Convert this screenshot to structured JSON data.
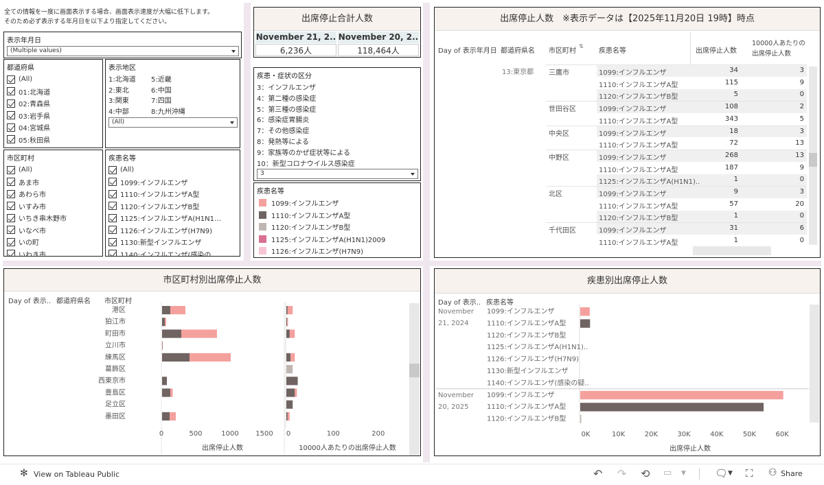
{
  "notice": {
    "line1": "全ての情報を一度に画面表示する場合、画面表示速度が大幅に低下します。",
    "line2": "そのため必ず表示する年月日を以下より指定してください。"
  },
  "date_filter": {
    "title": "表示年月日",
    "value": "(Multiple values)"
  },
  "pref_filter": {
    "title": "都道府県",
    "items": [
      "(All)",
      "01:北海道",
      "02:青森県",
      "03:岩手県",
      "04:宮城県",
      "05:秋田県"
    ]
  },
  "region_filter": {
    "title": "表示地区",
    "rows": [
      [
        "1:北海道",
        "5:近畿"
      ],
      [
        "2:東北",
        "6:中国"
      ],
      [
        "3:関東",
        "7:四国"
      ],
      [
        "4:中部",
        "8:九州沖縄"
      ]
    ],
    "value": "(All)"
  },
  "city_filter": {
    "title": "市区町村",
    "items": [
      "(All)",
      "あま市",
      "あわら市",
      "いすみ市",
      "いちき串木野市",
      "いなべ市",
      "いの町",
      "いわき市"
    ]
  },
  "disease_filter": {
    "title": "疾患名等",
    "items": [
      "(All)",
      "1099:インフルエンザ",
      "1110:インフルエンザA型",
      "1120:インフルエンザB型",
      "1125:インフルエンザA(H1N1…",
      "1126:インフルエンザ(H7N9)",
      "1130:新型インフルエンザ",
      "1140:インフルエンザ(感染の"
    ]
  },
  "total": {
    "title": "出席停止合計人数",
    "headers": [
      "November 21, 2..",
      "November 20, 2.."
    ],
    "values": [
      "6,236人",
      "118,464人"
    ]
  },
  "category_filter": {
    "title": "疾患・症状の区分",
    "items": [
      "3：インフルエンザ",
      "4：第二種の感染症",
      "5：第三種の感染症",
      "6：感染症胃腸炎",
      "7：その他感染症",
      "8：発熱等による",
      "9：家族等のかぜ症状等による",
      "10：新型コロナウイルス感染症"
    ],
    "value": "3"
  },
  "disease_legend": {
    "title": "疾患名等",
    "items": [
      {
        "label": "1099:インフルエンザ",
        "color": "#f4a19e"
      },
      {
        "label": "1110:インフルエンザA型",
        "color": "#6f6462"
      },
      {
        "label": "1120:インフルエンザB型",
        "color": "#bfb6b2"
      },
      {
        "label": "1125:インフルエンザA(H1N1)2009",
        "color": "#d9708f"
      },
      {
        "label": "1126:インフルエンザ(H7N9)",
        "color": "#f7c5d3"
      }
    ]
  },
  "table": {
    "title": "出席停止人数　※表示データは【2025年11月20日 19時】時点",
    "headers": {
      "date": "Day of 表示年月日",
      "pref": "都道府県名",
      "city": "市区町村",
      "disease": "疾患名等",
      "count": "出席停止人数",
      "rate": "10000人あたりの出席停止人数"
    },
    "pref_value": "13:東京都",
    "cities": [
      "三鷹市",
      "世田谷区",
      "中央区",
      "中野区",
      "北区",
      "千代田区"
    ],
    "rows": [
      {
        "disease": "1099:インフルエンザ",
        "count": "34",
        "rate": "3"
      },
      {
        "disease": "1110:インフルエンザA型",
        "count": "115",
        "rate": "9"
      },
      {
        "disease": "1120:インフルエンザB型",
        "count": "5",
        "rate": "0"
      },
      {
        "disease": "1099:インフルエンザ",
        "count": "108",
        "rate": "2"
      },
      {
        "disease": "1110:インフルエンザA型",
        "count": "343",
        "rate": "5"
      },
      {
        "disease": "1099:インフルエンザ",
        "count": "18",
        "rate": "3"
      },
      {
        "disease": "1110:インフルエンザA型",
        "count": "72",
        "rate": "13"
      },
      {
        "disease": "1099:インフルエンザ",
        "count": "268",
        "rate": "13"
      },
      {
        "disease": "1110:インフルエンザA型",
        "count": "187",
        "rate": "9"
      },
      {
        "disease": "1125:インフルエンザA(H1N1)..",
        "count": "1",
        "rate": "0"
      },
      {
        "disease": "1099:インフルエンザ",
        "count": "9",
        "rate": "3"
      },
      {
        "disease": "1110:インフルエンザA型",
        "count": "57",
        "rate": "20"
      },
      {
        "disease": "1120:インフルエンザB型",
        "count": "1",
        "rate": "0"
      },
      {
        "disease": "1099:インフルエンザ",
        "count": "31",
        "rate": "6"
      },
      {
        "disease": "1110:インフルエンザA型",
        "count": "1",
        "rate": "0"
      }
    ]
  },
  "chart_data": [
    {
      "type": "bar",
      "title": "市区町村別出席停止人数",
      "headers": [
        "Day of 表示..",
        "都道府県名",
        "市区町村"
      ],
      "categories": [
        "港区",
        "狛江市",
        "町田市",
        "立川市",
        "練馬区",
        "葛飾区",
        "西東京市",
        "豊島区",
        "足立区",
        "墨田区"
      ],
      "series": [
        {
          "name": "1110:インフルエンザA型",
          "color": "#6f6462",
          "values": [
            120,
            40,
            280,
            5,
            400,
            0,
            70,
            120,
            0,
            110
          ]
        },
        {
          "name": "1099:インフルエンザ",
          "color": "#f4a19e",
          "values": [
            220,
            20,
            520,
            5,
            600,
            0,
            0,
            35,
            0,
            90
          ]
        },
        {
          "name": "1120:インフルエンザB型",
          "color": "#bfb6b2",
          "values": [
            0,
            0,
            0,
            0,
            0,
            0,
            0,
            0,
            0,
            0
          ]
        }
      ],
      "xlabel": "出席停止人数",
      "xticks": [
        "0",
        "500",
        "1000",
        "1500"
      ],
      "xlim": [
        0,
        1600
      ],
      "rate_series": [
        {
          "name": "1110:インフルエンザA型",
          "color": "#6f6462",
          "values": [
            3,
            2,
            8,
            0,
            10,
            0,
            27,
            20,
            15,
            3
          ]
        },
        {
          "name": "1099:インフルエンザ",
          "color": "#f4a19e",
          "values": [
            12,
            2,
            12,
            0,
            10,
            0,
            0,
            5,
            0,
            5
          ]
        },
        {
          "name": "1120:インフルエンザB型",
          "color": "#bfb6b2",
          "values": [
            0,
            0,
            0,
            0,
            0,
            15,
            0,
            0,
            0,
            0
          ]
        }
      ],
      "rate_xlabel": "10000人あたりの出席停止人数",
      "rate_xticks": [
        "0",
        "100",
        "200"
      ],
      "rate_xlim": [
        0,
        260
      ]
    },
    {
      "type": "bar",
      "title": "疾患別出席停止人数",
      "headers": [
        "Day of 表示..",
        "疾患名等"
      ],
      "groups": [
        {
          "date": [
            "November",
            "21, 2024"
          ],
          "items": [
            {
              "label": "1099:インフルエンザ",
              "value": 2900,
              "color": "#f4a19e"
            },
            {
              "label": "1110:インフルエンザA型",
              "value": 3000,
              "color": "#6f6462"
            },
            {
              "label": "1120:インフルエンザB型",
              "value": 0,
              "color": "#bfb6b2"
            },
            {
              "label": "1125:インフルエンザA(H1N1)..",
              "value": 0,
              "color": "#d9708f"
            },
            {
              "label": "1126:インフルエンザ(H7N9)",
              "value": 0,
              "color": "#f7c5d3"
            },
            {
              "label": "1130:新型インフルエンザ",
              "value": 0,
              "color": "#f4a19e"
            },
            {
              "label": "1140:インフルエンザ(感染の疑..",
              "value": 0,
              "color": "#f4a19e"
            }
          ]
        },
        {
          "date": [
            "November",
            "20, 2025"
          ],
          "items": [
            {
              "label": "1099:インフルエンザ",
              "value": 62000,
              "color": "#f4a19e"
            },
            {
              "label": "1110:インフルエンザA型",
              "value": 56000,
              "color": "#6f6462"
            },
            {
              "label": "1120:インフルエンザB型",
              "value": 300,
              "color": "#bfb6b2"
            }
          ]
        }
      ],
      "xlabel": "出席停止人数",
      "xticks": [
        "0K",
        "10K",
        "20K",
        "30K",
        "40K",
        "50K",
        "60K"
      ],
      "xlim": [
        0,
        65000
      ]
    }
  ],
  "footer": {
    "view_label": "View on Tableau Public",
    "share_label": "Share"
  }
}
